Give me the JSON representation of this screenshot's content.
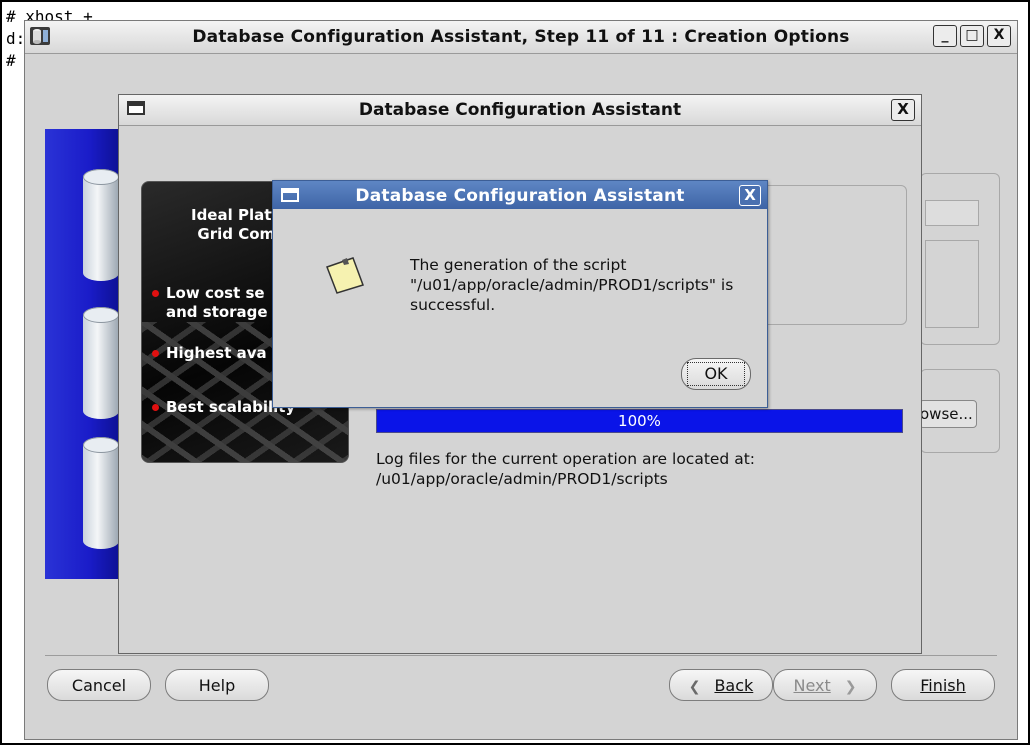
{
  "terminal": {
    "lines": "# xhost +\nd:\n#"
  },
  "main_window": {
    "title": "Database Configuration Assistant, Step 11 of 11 : Creation Options",
    "wm_buttons": {
      "minimize": "_",
      "maximize": "□",
      "close": "X"
    },
    "browse_label": "owse...",
    "buttons": {
      "cancel": "Cancel",
      "help": "Help",
      "back": "Back",
      "next": "Next",
      "finish": "Finish"
    }
  },
  "progress_dialog": {
    "title": "Database Configuration Assistant",
    "close_glyph": "X",
    "promo": {
      "title": "Ideal Platforr\nGrid Compu",
      "bullets": [
        "Low cost se\nand storage",
        "Highest ava",
        "Best scalability"
      ]
    },
    "progress": {
      "value": 100,
      "label": "100%"
    },
    "log_text": "Log files for the current operation are located at:\n/u01/app/oracle/admin/PROD1/scripts"
  },
  "message_dialog": {
    "title": "Database Configuration Assistant",
    "close_glyph": "X",
    "message": "The generation of the script\n\"/u01/app/oracle/admin/PROD1/scripts\" is\nsuccessful.",
    "ok_label": "OK"
  },
  "icons": {
    "app": "database-icon",
    "note": "note-icon",
    "back": "chevron-left-icon",
    "next": "chevron-right-icon"
  }
}
